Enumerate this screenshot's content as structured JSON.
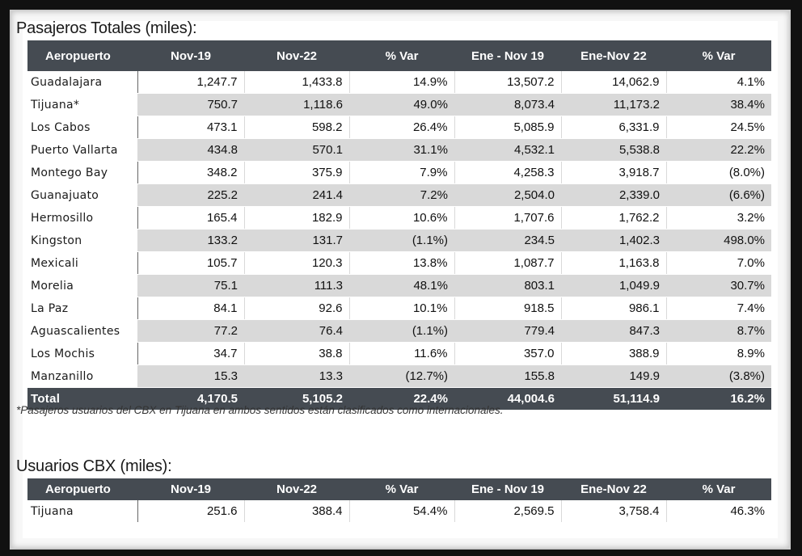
{
  "table1": {
    "title": "Pasajeros Totales (miles):",
    "headers": [
      "Aeropuerto",
      "Nov-19",
      "Nov-22",
      "% Var",
      "Ene - Nov  19",
      "Ene-Nov 22",
      "% Var"
    ],
    "rows": [
      [
        "Guadalajara",
        "1,247.7",
        "1,433.8",
        "14.9%",
        "13,507.2",
        "14,062.9",
        "4.1%"
      ],
      [
        "Tijuana*",
        "750.7",
        "1,118.6",
        "49.0%",
        "8,073.4",
        "11,173.2",
        "38.4%"
      ],
      [
        "Los Cabos",
        "473.1",
        "598.2",
        "26.4%",
        "5,085.9",
        "6,331.9",
        "24.5%"
      ],
      [
        "Puerto Vallarta",
        "434.8",
        "570.1",
        "31.1%",
        "4,532.1",
        "5,538.8",
        "22.2%"
      ],
      [
        "Montego Bay",
        "348.2",
        "375.9",
        "7.9%",
        "4,258.3",
        "3,918.7",
        "(8.0%)"
      ],
      [
        "Guanajuato",
        "225.2",
        "241.4",
        "7.2%",
        "2,504.0",
        "2,339.0",
        "(6.6%)"
      ],
      [
        "Hermosillo",
        "165.4",
        "182.9",
        "10.6%",
        "1,707.6",
        "1,762.2",
        "3.2%"
      ],
      [
        "Kingston",
        "133.2",
        "131.7",
        "(1.1%)",
        "234.5",
        "1,402.3",
        "498.0%"
      ],
      [
        "Mexicali",
        "105.7",
        "120.3",
        "13.8%",
        "1,087.7",
        "1,163.8",
        "7.0%"
      ],
      [
        "Morelia",
        "75.1",
        "111.3",
        "48.1%",
        "803.1",
        "1,049.9",
        "30.7%"
      ],
      [
        "La Paz",
        "84.1",
        "92.6",
        "10.1%",
        "918.5",
        "986.1",
        "7.4%"
      ],
      [
        "Aguascalientes",
        "77.2",
        "76.4",
        "(1.1%)",
        "779.4",
        "847.3",
        "8.7%"
      ],
      [
        "Los Mochis",
        "34.7",
        "38.8",
        "11.6%",
        "357.0",
        "388.9",
        "8.9%"
      ],
      [
        "Manzanillo",
        "15.3",
        "13.3",
        "(12.7%)",
        "155.8",
        "149.9",
        "(3.8%)"
      ]
    ],
    "total": [
      "Total",
      "4,170.5",
      "5,105.2",
      "22.4%",
      "44,004.6",
      "51,114.9",
      "16.2%"
    ],
    "note": "*Pasajeros usuarios del CBX en Tijuana en ambos sentidos están clasificados como internacionales."
  },
  "table2": {
    "title": "Usuarios CBX (miles):",
    "headers": [
      "Aeropuerto",
      "Nov-19",
      "Nov-22",
      "% Var",
      "Ene - Nov  19",
      "Ene-Nov 22",
      "% Var"
    ],
    "rows": [
      [
        "Tijuana",
        "251.6",
        "388.4",
        "54.4%",
        "2,569.5",
        "3,758.4",
        "46.3%"
      ]
    ]
  }
}
